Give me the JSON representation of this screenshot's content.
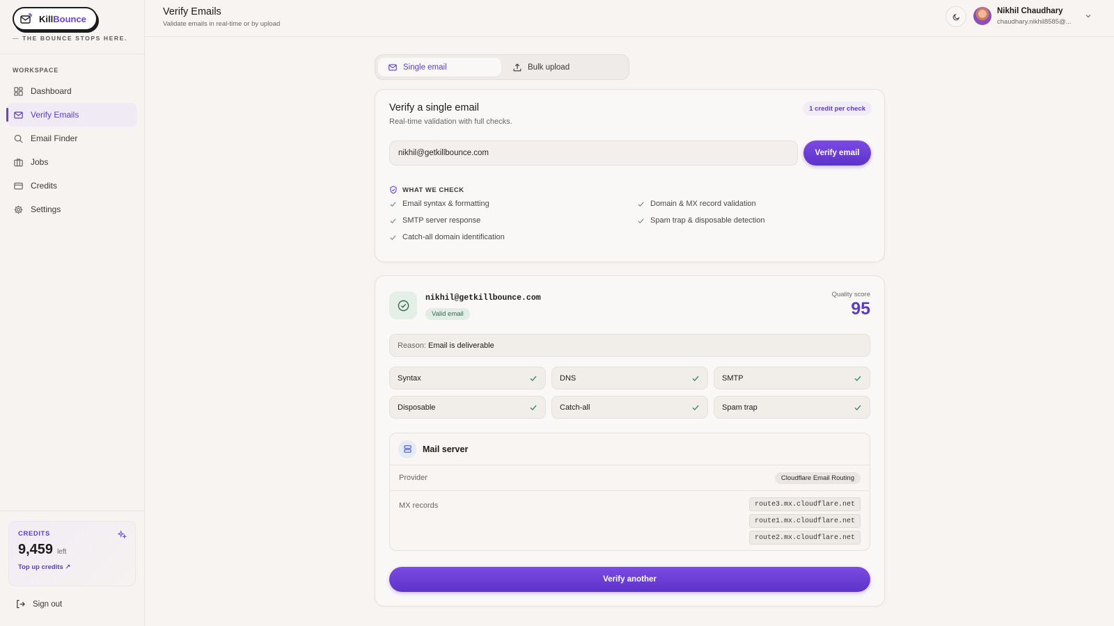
{
  "brand": {
    "name_part1": "Kill",
    "name_part2": "Bounce",
    "tagline": "THE BOUNCE STOPS HERE.",
    "accent_color": "#6a3fd6"
  },
  "sidebar": {
    "section_label": "WORKSPACE",
    "items": [
      {
        "label": "Dashboard",
        "icon": "grid-icon",
        "active": false
      },
      {
        "label": "Verify Emails",
        "icon": "mail-icon",
        "active": true
      },
      {
        "label": "Email Finder",
        "icon": "search-icon",
        "active": false
      },
      {
        "label": "Jobs",
        "icon": "briefcase-icon",
        "active": false
      },
      {
        "label": "Credits",
        "icon": "card-icon",
        "active": false
      },
      {
        "label": "Settings",
        "icon": "gear-icon",
        "active": false
      }
    ],
    "credits": {
      "label": "CREDITS",
      "value": "9,459",
      "suffix": "left",
      "topup_label": "Top up credits"
    },
    "signout_label": "Sign out"
  },
  "header": {
    "title": "Verify Emails",
    "subtitle": "Validate emails in real-time or by upload",
    "user_name": "Nikhil Chaudhary",
    "user_email": "chaudhary.nikhil8585@..."
  },
  "tabs": [
    {
      "label": "Single email",
      "icon": "mail-icon",
      "active": true
    },
    {
      "label": "Bulk upload",
      "icon": "upload-icon",
      "active": false
    }
  ],
  "single": {
    "title": "Verify a single email",
    "subtitle": "Real-time validation with full checks.",
    "credit_badge": "1 credit per check",
    "input_value": "nikhil@getkillbounce.com",
    "button_label": "Verify email",
    "checks_title": "WHAT WE CHECK",
    "checks": [
      "Email syntax & formatting",
      "Domain & MX record validation",
      "SMTP server response",
      "Spam trap & disposable detection",
      "Catch-all domain identification"
    ]
  },
  "result": {
    "email": "nikhil@getkillbounce.com",
    "status_badge": "Valid email",
    "quality_label": "Quality score",
    "quality_score": "95",
    "reason_label": "Reason:",
    "reason_text": "Email is deliverable",
    "checks": [
      {
        "label": "Syntax",
        "passed": true
      },
      {
        "label": "DNS",
        "passed": true
      },
      {
        "label": "SMTP",
        "passed": true
      },
      {
        "label": "Disposable",
        "passed": true
      },
      {
        "label": "Catch-all",
        "passed": true
      },
      {
        "label": "Spam trap",
        "passed": true
      }
    ],
    "mail_server": {
      "title": "Mail server",
      "provider_label": "Provider",
      "provider_value": "Cloudflare Email Routing",
      "mx_label": "MX records",
      "mx_records": [
        "route3.mx.cloudflare.net",
        "route1.mx.cloudflare.net",
        "route2.mx.cloudflare.net"
      ]
    },
    "again_label": "Verify another"
  }
}
